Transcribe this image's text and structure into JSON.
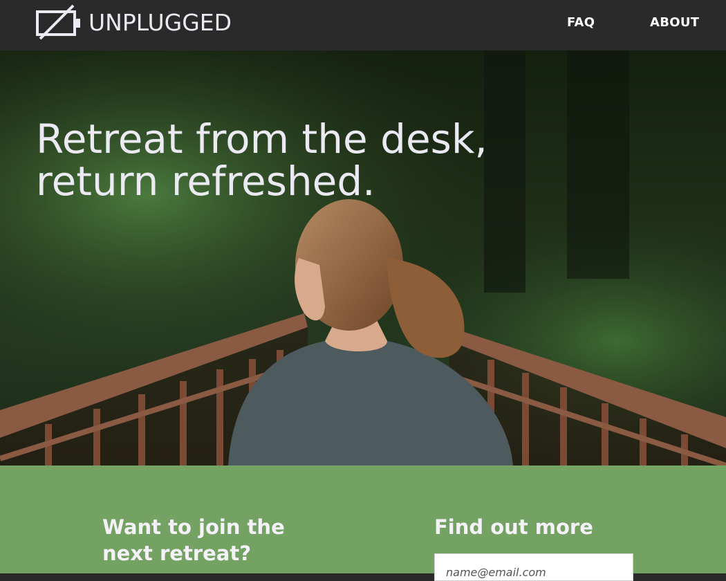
{
  "header": {
    "brand": "UNPLUGGED",
    "nav": [
      {
        "label": "FAQ"
      },
      {
        "label": "ABOUT"
      }
    ]
  },
  "hero": {
    "headline_line1": "Retreat from the desk,",
    "headline_line2": "return refreshed."
  },
  "signup": {
    "join_heading": "Want to join the next retreat?",
    "find_heading": "Find out more",
    "email_placeholder": "name@email.com"
  },
  "colors": {
    "header_bg": "#2a2a2a",
    "band_bg": "#73a262",
    "text_light": "#ebe9f2"
  }
}
